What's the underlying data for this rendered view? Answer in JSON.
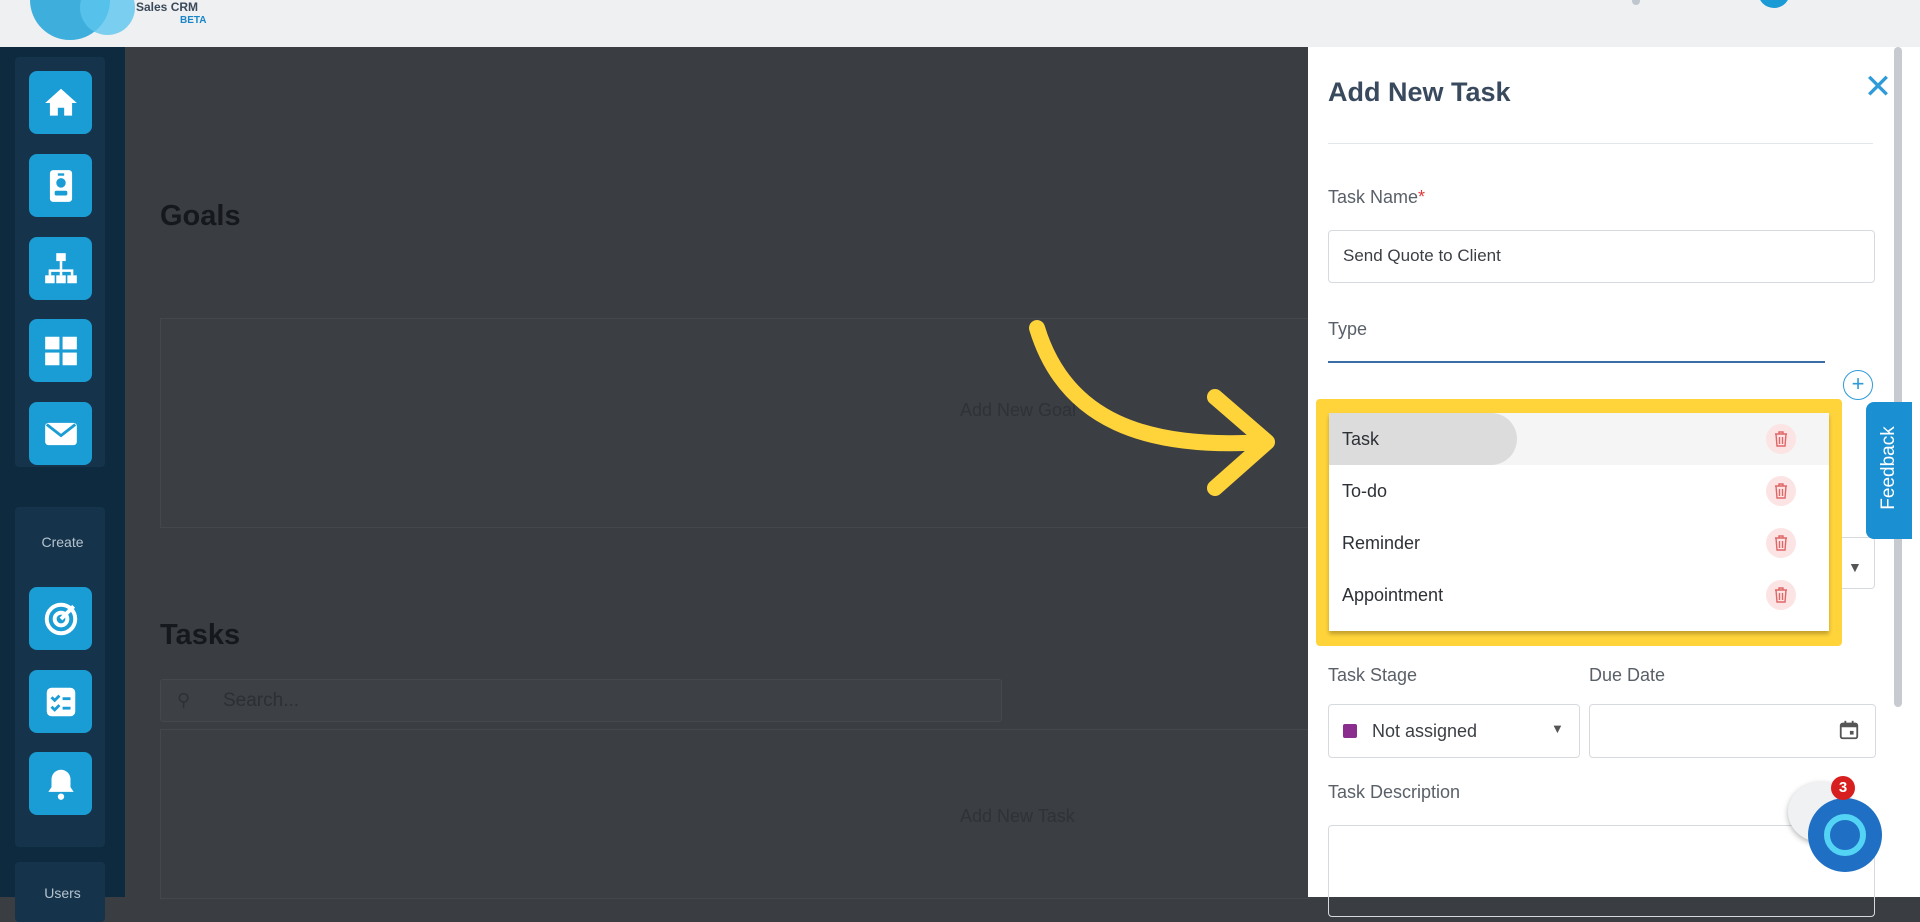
{
  "app": {
    "logo_text": "Sales CRM",
    "beta": "BETA"
  },
  "sidebar": {
    "create_label": "Create",
    "users_label": "Users",
    "nav": [
      {
        "icon": "home-icon"
      },
      {
        "icon": "contact-card-icon"
      },
      {
        "icon": "hierarchy-icon"
      },
      {
        "icon": "grid-icon"
      },
      {
        "icon": "mail-icon"
      }
    ],
    "create_items": [
      {
        "icon": "target-icon"
      },
      {
        "icon": "checklist-icon"
      },
      {
        "icon": "bell-icon"
      }
    ]
  },
  "main": {
    "goals_title": "Goals",
    "goals_empty": "Add New Goal",
    "tasks_title": "Tasks",
    "tasks_empty": "Add New Task",
    "search_placeholder": "Search..."
  },
  "drawer": {
    "title": "Add New Task",
    "task_name_label": "Task Name",
    "required_mark": "*",
    "task_name_value": "Send Quote to Client",
    "type_label": "Type",
    "type_options": [
      "Task",
      "To-do",
      "Reminder",
      "Appointment"
    ],
    "task_stage_label": "Task Stage",
    "task_stage_value": "Not assigned",
    "due_date_label": "Due Date",
    "task_description_label": "Task Description"
  },
  "feedback_label": "Feedback",
  "chat_badge": "3",
  "colors": {
    "accent": "#1a9cd4",
    "highlight": "#ffd43b",
    "sidebar_bg": "#0d2a3f",
    "stage_swatch": "#8b2d8f"
  }
}
